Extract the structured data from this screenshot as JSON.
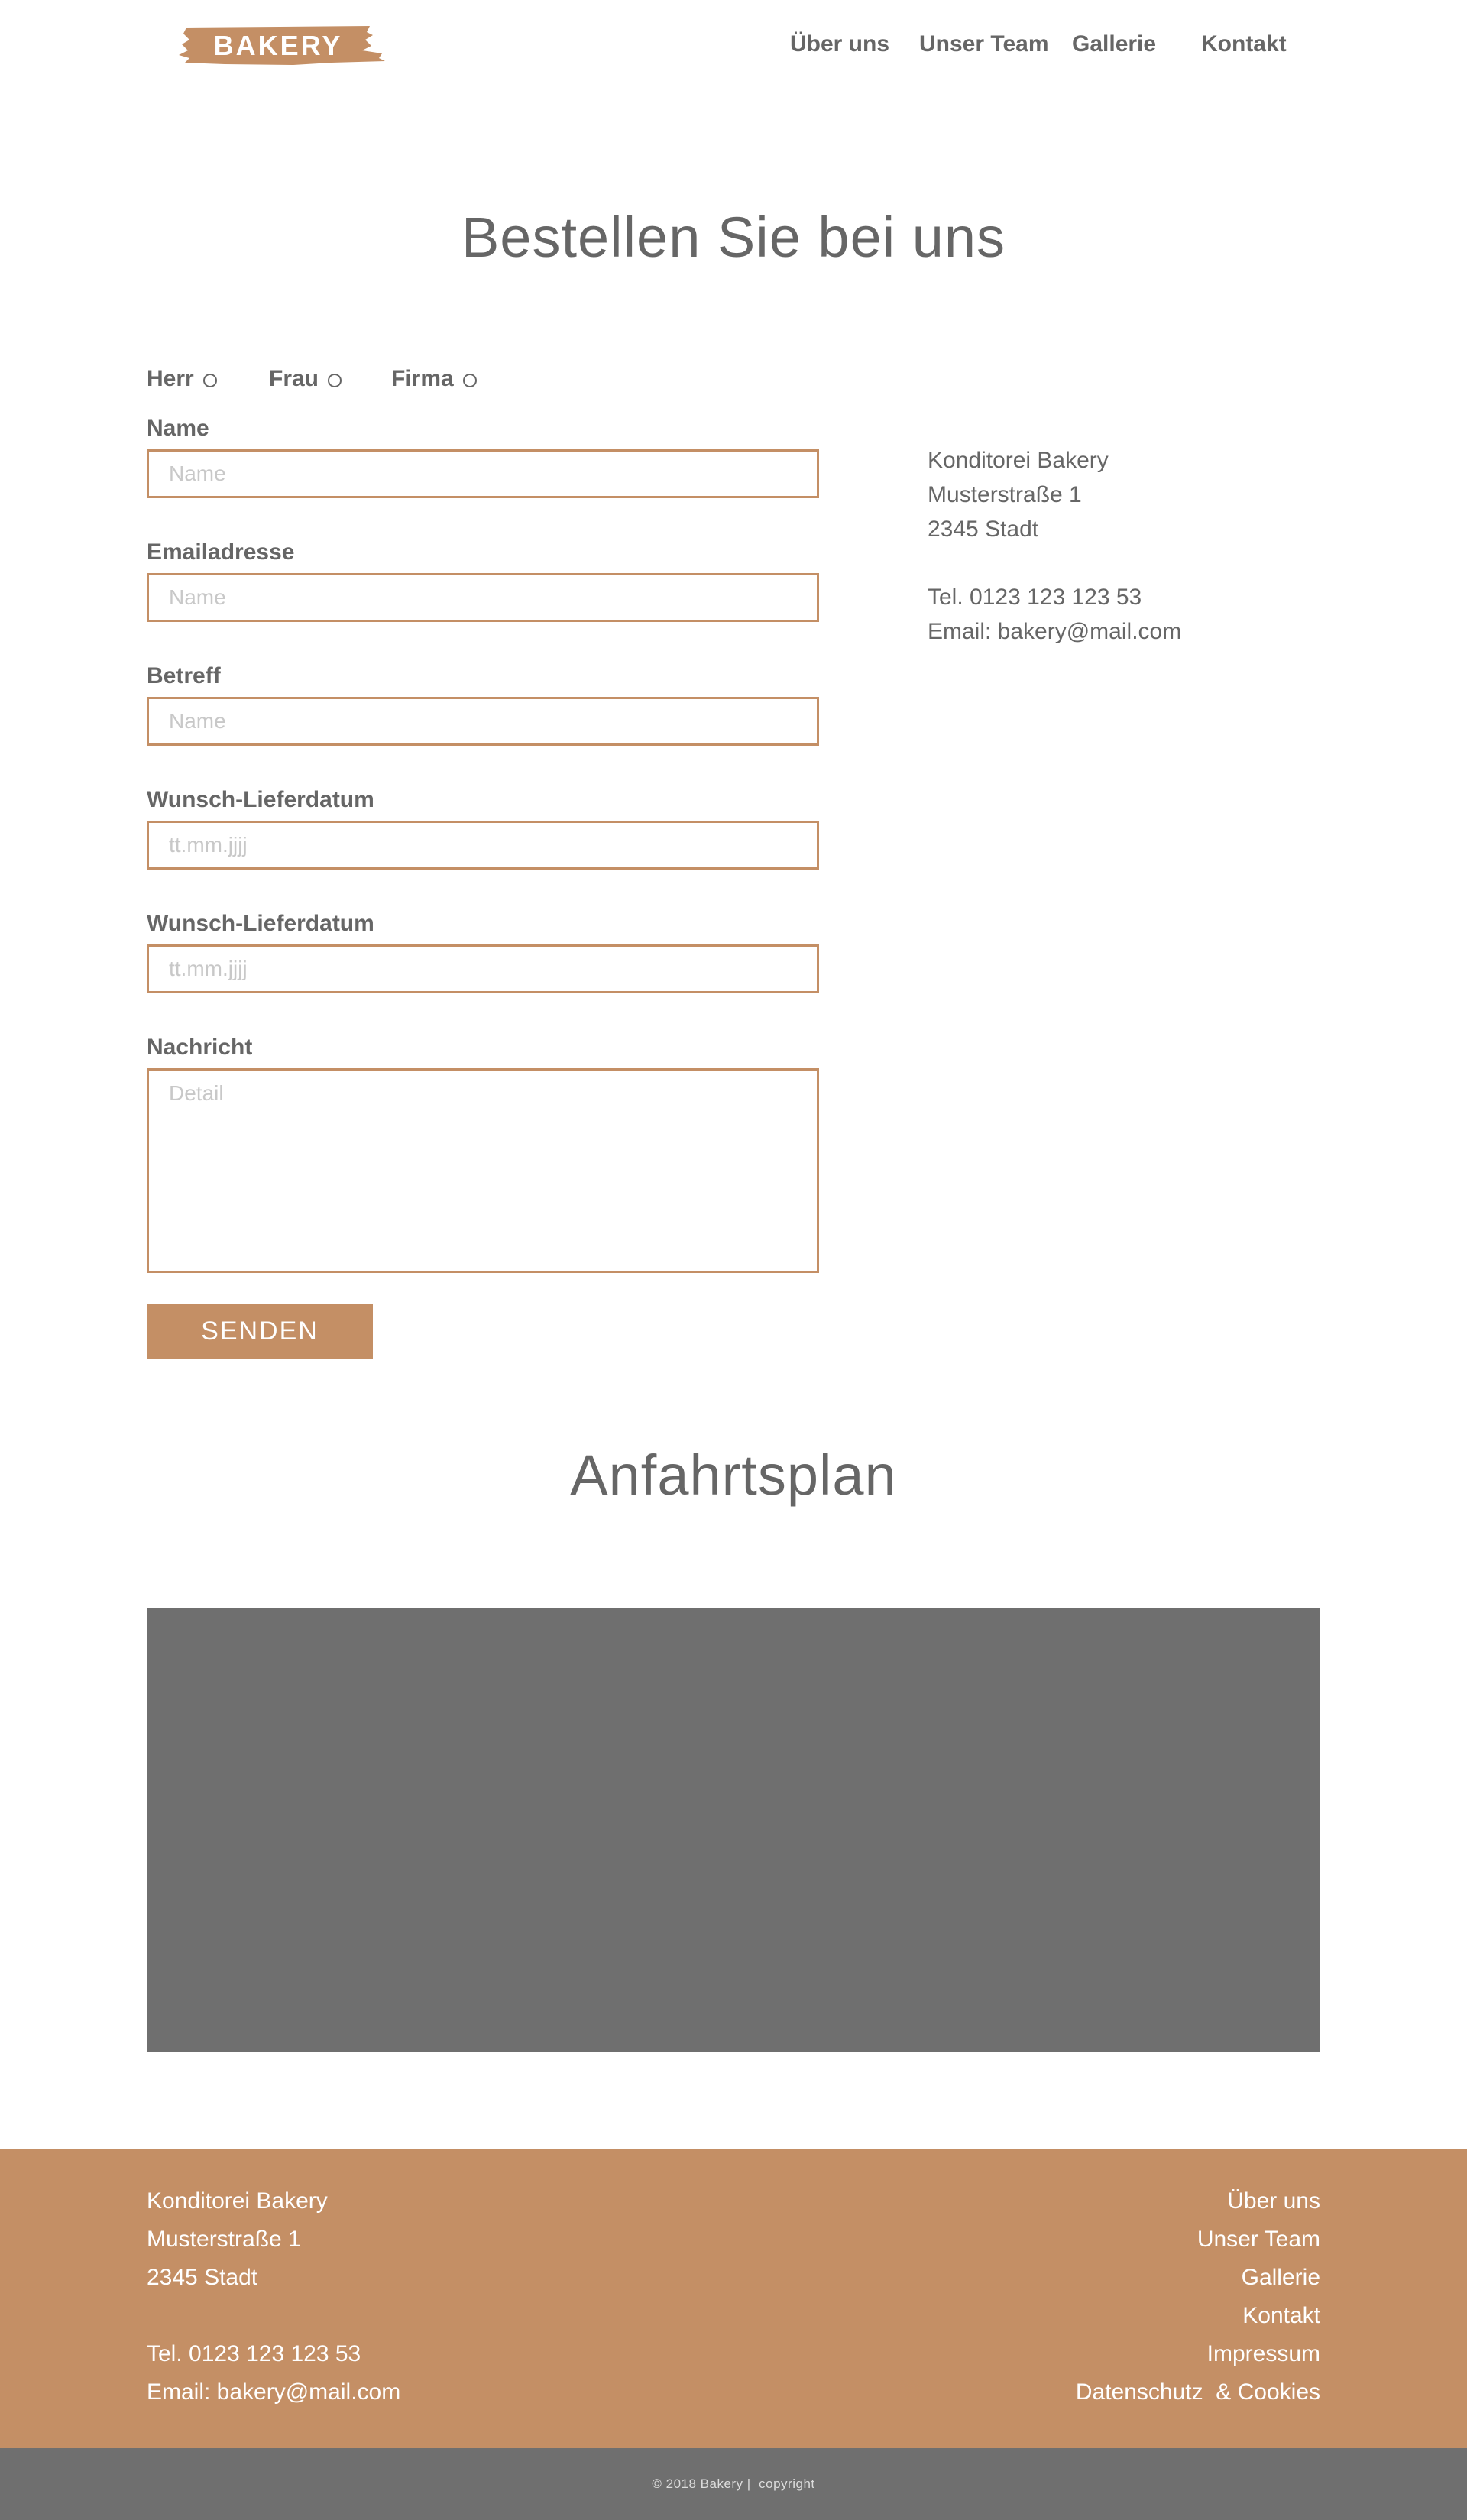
{
  "header": {
    "logo_text": "BAKERY",
    "nav": [
      "Über uns",
      "Unser Team",
      "Gallerie",
      "Kontakt"
    ]
  },
  "order": {
    "title": "Bestellen Sie bei uns",
    "salutations": [
      "Herr",
      "Frau",
      "Firma"
    ],
    "fields": [
      {
        "label": "Name",
        "placeholder": "Name"
      },
      {
        "label": "Emailadresse",
        "placeholder": "Name"
      },
      {
        "label": "Betreff",
        "placeholder": "Name"
      },
      {
        "label": "Wunsch-Lieferdatum",
        "placeholder": "tt.mm.jjjj"
      },
      {
        "label": "Wunsch-Lieferdatum",
        "placeholder": "tt.mm.jjjj"
      }
    ],
    "message_label": "Nachricht",
    "message_placeholder": "Detail",
    "submit_label": "SENDEN"
  },
  "contact": {
    "name": "Konditorei Bakery",
    "street": "Musterstraße 1",
    "city": "2345 Stadt",
    "phone": "Tel. 0123 123 123 53",
    "email": "Email: bakery@mail.com"
  },
  "directions": {
    "title": "Anfahrtsplan"
  },
  "footer": {
    "name": "Konditorei Bakery",
    "street": "Musterstraße 1",
    "city": "2345 Stadt",
    "phone": "Tel. 0123 123 123 53",
    "email": "Email: bakery@mail.com",
    "links": [
      "Über uns",
      "Unser Team",
      "Gallerie",
      "Kontakt",
      "Impressum",
      "Datenschutz  & Cookies"
    ]
  },
  "copyright": "© 2018 Bakery |  copyright",
  "colors": {
    "accent": "#c48f65",
    "text": "#666666",
    "map_placeholder": "#6f6f6f"
  }
}
